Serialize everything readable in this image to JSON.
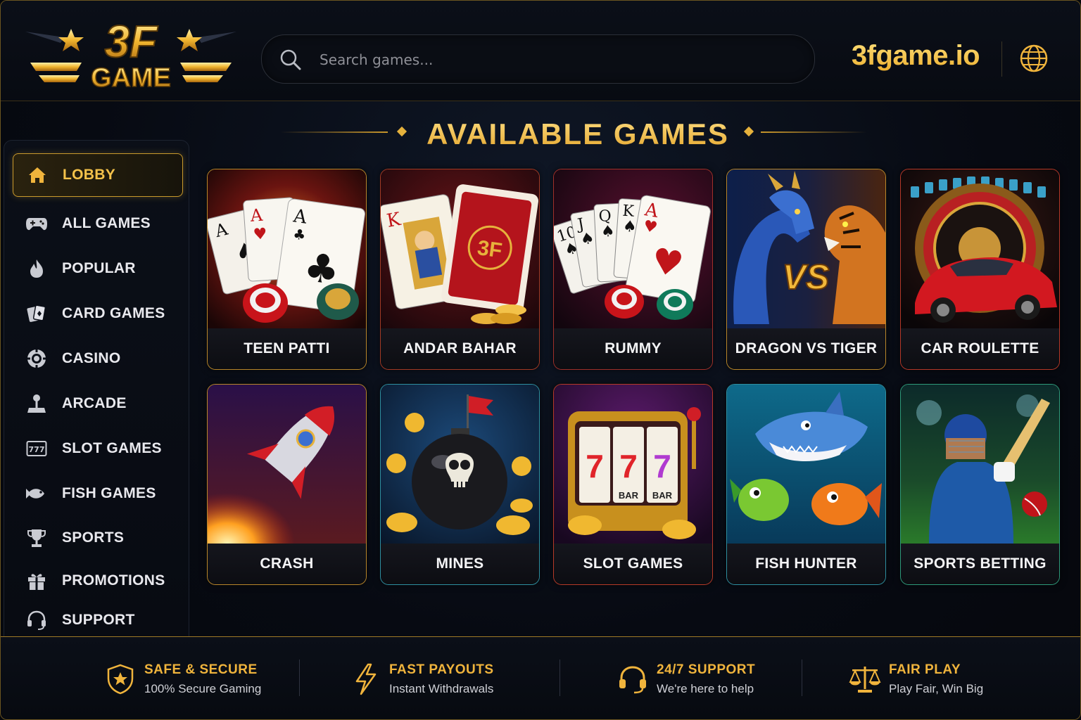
{
  "brand": {
    "logo_top": "3F",
    "logo_bottom": "GAME",
    "domain": "3fgame.io"
  },
  "search": {
    "placeholder": "Search games..."
  },
  "section_title": "AVAILABLE GAMES",
  "sidebar": {
    "items": [
      {
        "label": "LOBBY",
        "icon": "home-icon",
        "active": true
      },
      {
        "label": "ALL GAMES",
        "icon": "gamepad-icon"
      },
      {
        "label": "POPULAR",
        "icon": "flame-icon"
      },
      {
        "label": "CARD GAMES",
        "icon": "cards-icon"
      },
      {
        "label": "CASINO",
        "icon": "casino-chip-icon"
      },
      {
        "label": "ARCADE",
        "icon": "joystick-icon"
      },
      {
        "label": "SLOT GAMES",
        "icon": "slot-777-icon"
      },
      {
        "label": "FISH GAMES",
        "icon": "fish-icon"
      },
      {
        "label": "SPORTS",
        "icon": "trophy-icon"
      },
      {
        "label": "PROMOTIONS",
        "icon": "gift-icon"
      },
      {
        "label": "SUPPORT",
        "icon": "headset-icon"
      }
    ]
  },
  "games": [
    {
      "name": "TEEN PATTI",
      "art": "aces-cards-chips",
      "accent": "#b8862a"
    },
    {
      "name": "ANDAR BAHAR",
      "art": "king-card-3f",
      "accent": "#b0402a"
    },
    {
      "name": "RUMMY",
      "art": "royal-flush-chips",
      "accent": "#b8862a"
    },
    {
      "name": "DRAGON VS TIGER",
      "art": "dragon-tiger",
      "accent": "#b8862a"
    },
    {
      "name": "CAR ROULETTE",
      "art": "roulette-red-car",
      "accent": "#c23a2a"
    },
    {
      "name": "CRASH",
      "art": "rocket",
      "accent": "#b8862a"
    },
    {
      "name": "MINES",
      "art": "skull-bomb-coins",
      "accent": "#2e8fa0"
    },
    {
      "name": "SLOT GAMES",
      "art": "slot-machine-777",
      "accent": "#c0402a"
    },
    {
      "name": "FISH HUNTER",
      "art": "shark-fish",
      "accent": "#2e8fa0"
    },
    {
      "name": "SPORTS BETTING",
      "art": "cricket-batsman",
      "accent": "#2e9a7a"
    }
  ],
  "footer": {
    "features": [
      {
        "title": "SAFE & SECURE",
        "subtitle": "100% Secure Gaming",
        "icon": "shield-star-icon"
      },
      {
        "title": "FAST PAYOUTS",
        "subtitle": "Instant Withdrawals",
        "icon": "lightning-icon"
      },
      {
        "title": "24/7 SUPPORT",
        "subtitle": "We're here to help",
        "icon": "headset-icon"
      },
      {
        "title": "FAIR PLAY",
        "subtitle": "Play Fair, Win Big",
        "icon": "scales-icon"
      }
    ]
  },
  "colors": {
    "gold": "#f0b43c",
    "gold_dark": "#c8962b",
    "bg": "#05070c"
  }
}
